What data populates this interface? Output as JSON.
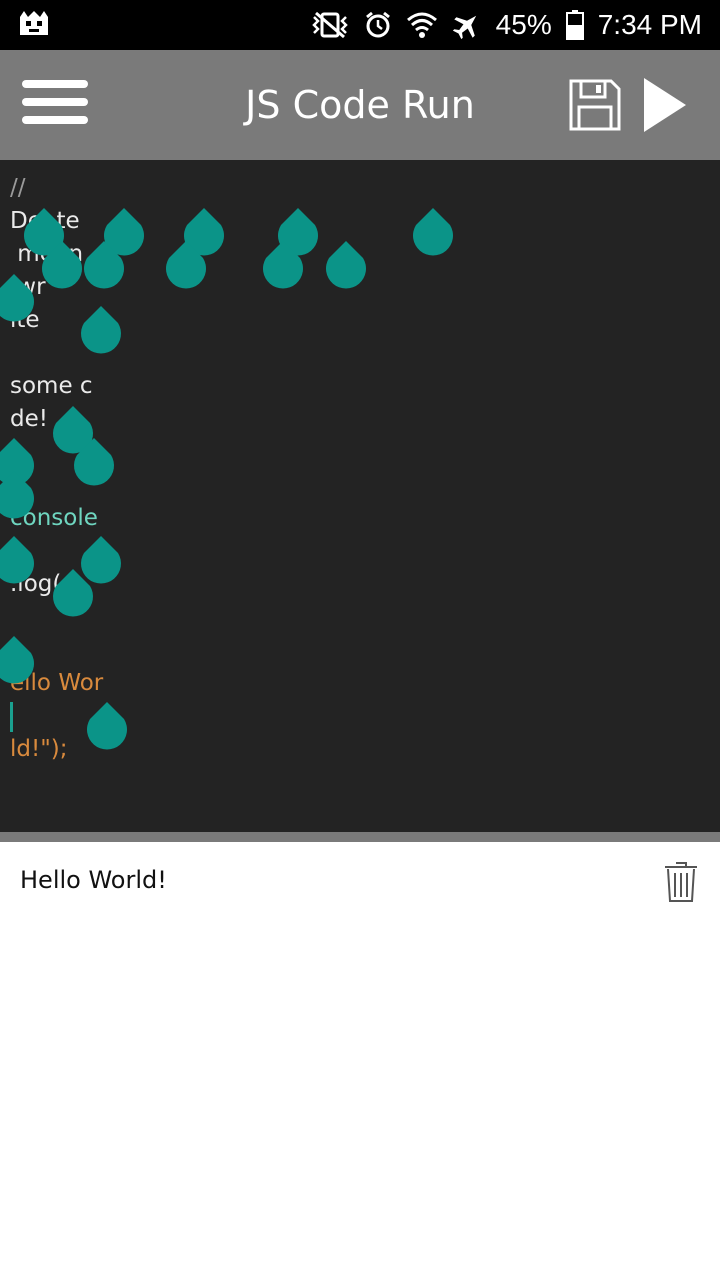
{
  "status_bar": {
    "battery_percent": "45%",
    "time": "7:34 PM",
    "icons": [
      "notification-app-icon",
      "vibrate-mute-icon",
      "alarm-icon",
      "wifi-icon",
      "airplane-icon",
      "battery-icon"
    ]
  },
  "app_bar": {
    "title": "JS Code Run",
    "menu_icon": "hamburger-menu-icon",
    "save_icon": "floppy-disk-icon",
    "run_icon": "play-icon",
    "background": "#7a7a7a"
  },
  "editor": {
    "background": "#232323",
    "lines": [
      {
        "text": "//",
        "kind": "comment"
      },
      {
        "text": "De  te",
        "kind": "plain"
      },
      {
        "text": " me  n",
        "kind": "plain"
      },
      {
        "text": " wr",
        "kind": "plain"
      },
      {
        "text": "ite",
        "kind": "plain"
      },
      {
        "text": "",
        "kind": "plain"
      },
      {
        "text": "some c",
        "kind": "plain"
      },
      {
        "text": "de!",
        "kind": "plain"
      },
      {
        "text": "",
        "kind": "plain"
      },
      {
        "text": "",
        "kind": "plain"
      },
      {
        "text": "console",
        "kind": "obj"
      },
      {
        "text": "",
        "kind": "plain"
      },
      {
        "text": ".log(",
        "kind": "plain"
      },
      {
        "text": "",
        "kind": "plain"
      },
      {
        "text": "",
        "kind": "plain"
      },
      {
        "text": "ello Wor",
        "kind": "str"
      },
      {
        "text": "",
        "kind": "caret"
      },
      {
        "text": "ld!\");",
        "kind": "str_end"
      }
    ],
    "overlay_color": "#0b9488"
  },
  "console": {
    "output": "Hello World!",
    "clear_icon": "trash-can-icon"
  }
}
